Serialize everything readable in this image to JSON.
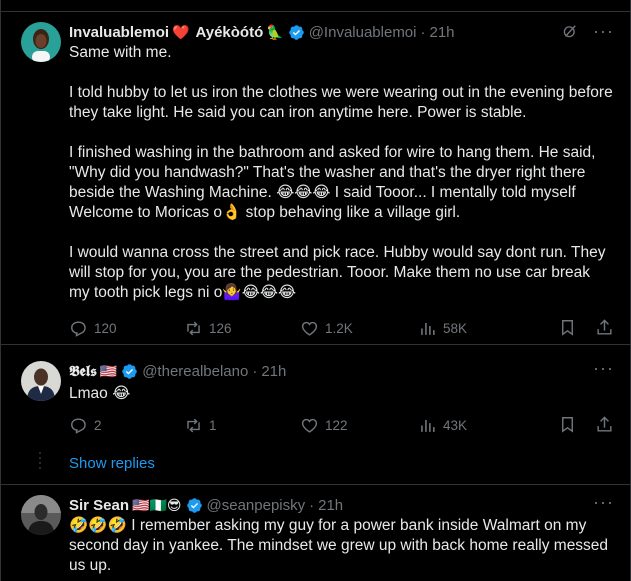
{
  "tweets": [
    {
      "name": "Invaluablemoi",
      "name_emoji_1": "❤️",
      "name_suffix": "Ayékòótó",
      "name_emoji_2": "🦜",
      "handle": "@Invaluablemoi",
      "time": "21h",
      "text": "Same with me.\n\nI told hubby to let us iron the clothes we were wearing out in the evening before they take light. He said you can iron anytime here. Power is stable.\n\nI finished washing in the bathroom and asked for wire to hang them. He said, \"Why did you handwash?\" That's the washer and that's the dryer right there beside the Washing Machine.  😂😂😂 I said Tooor... I mentally told myself Welcome to Moricas o👌 stop behaving like a village girl.\n\nI would wanna cross the street and pick race. Hubby would say dont run. They will stop for you, you are the pedestrian.  Tooor. Make them no use car break my tooth pick legs ni o🤷‍♀️😂😂😂",
      "replies": "120",
      "reposts": "126",
      "likes": "1.2K",
      "views": "58K"
    },
    {
      "name": "𝕭𝖊𝖑𝖘",
      "name_flag": "🇺🇸",
      "handle": "@therealbelano",
      "time": "21h",
      "text": "Lmao 😂",
      "replies": "2",
      "reposts": "1",
      "likes": "122",
      "views": "43K"
    },
    {
      "name": "Sir Sean",
      "name_emojis": "🇺🇸🇳🇬😎",
      "handle": "@seanpepisky",
      "time": "21h",
      "text": "🤣🤣🤣 I remember asking my guy for a power bank inside Walmart on my second day in yankee. The mindset we grew up with back home really messed us up."
    }
  ],
  "show_replies": "Show replies",
  "colors": {
    "background": "#000000",
    "text": "#e7e9ea",
    "muted": "#71767b",
    "accent": "#1d9bf0",
    "border": "#2f3336"
  },
  "icons": [
    "grok-icon",
    "more-icon",
    "reply-icon",
    "repost-icon",
    "like-icon",
    "views-icon",
    "bookmark-icon",
    "share-icon",
    "verified-badge-icon"
  ]
}
